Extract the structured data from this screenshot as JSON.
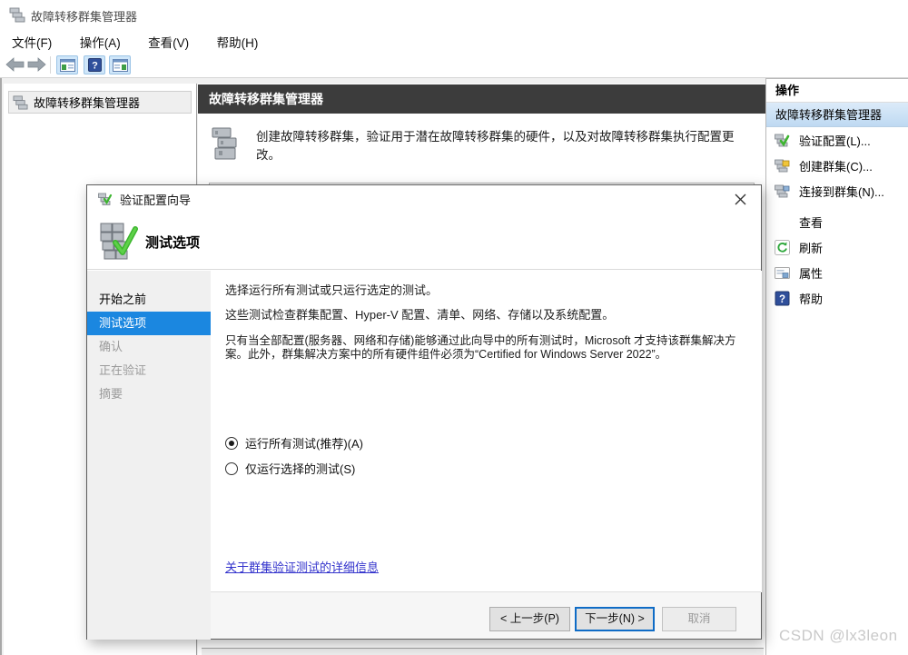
{
  "colors": {
    "step_highlight": "#1b87e0",
    "center_header_bar": "#3c3c3c",
    "selected_action_bg": "#cfe3f6",
    "ribbon_blue": "#17497f",
    "link": "#3333cc",
    "next_button_focus_border": "#0f6cc6"
  },
  "window": {
    "title": "故障转移群集管理器"
  },
  "menu": {
    "items": [
      "文件(F)",
      "操作(A)",
      "查看(V)",
      "帮助(H)"
    ]
  },
  "tree": {
    "root": "故障转移群集管理器"
  },
  "center": {
    "header": "故障转移群集管理器",
    "description": "创建故障转移群集，验证用于潜在故障转移群集的硬件，以及对故障转移群集执行配置更改。"
  },
  "actions": {
    "title": "操作",
    "selected_item": "故障转移群集管理器",
    "items": [
      {
        "label": "验证配置(L)...",
        "icon": "cluster-validate-icon"
      },
      {
        "label": "创建群集(C)...",
        "icon": "cluster-create-icon"
      },
      {
        "label": "连接到群集(N)...",
        "icon": "cluster-connect-icon"
      },
      {
        "label": "查看",
        "icon": ""
      },
      {
        "label": "刷新",
        "icon": "refresh-icon"
      },
      {
        "label": "属性",
        "icon": "properties-icon"
      },
      {
        "label": "帮助",
        "icon": "help-icon"
      }
    ]
  },
  "wizard": {
    "title": "验证配置向导",
    "heading": "测试选项",
    "steps": [
      {
        "label": "开始之前",
        "state": "default"
      },
      {
        "label": "测试选项",
        "state": "current"
      },
      {
        "label": "确认",
        "state": "pending"
      },
      {
        "label": "正在验证",
        "state": "pending"
      },
      {
        "label": "摘要",
        "state": "pending"
      }
    ],
    "paragraphs": [
      "选择运行所有测试或只运行选定的测试。",
      "这些测试检查群集配置、Hyper-V 配置、清单、网络、存储以及系统配置。",
      "只有当全部配置(服务器、网络和存储)能够通过此向导中的所有测试时，Microsoft 才支持该群集解决方案。此外，群集解决方案中的所有硬件组件必须为“Certified for Windows Server 2022”。"
    ],
    "radios": [
      {
        "label": "运行所有测试(推荐)(A)",
        "selected": true
      },
      {
        "label": "仅运行选择的测试(S)",
        "selected": false
      }
    ],
    "link": "关于群集验证测试的详细信息",
    "buttons": {
      "back": "< 上一步(P)",
      "next": "下一步(N) >",
      "cancel": "取消"
    }
  },
  "watermark": "CSDN @lx3leon"
}
